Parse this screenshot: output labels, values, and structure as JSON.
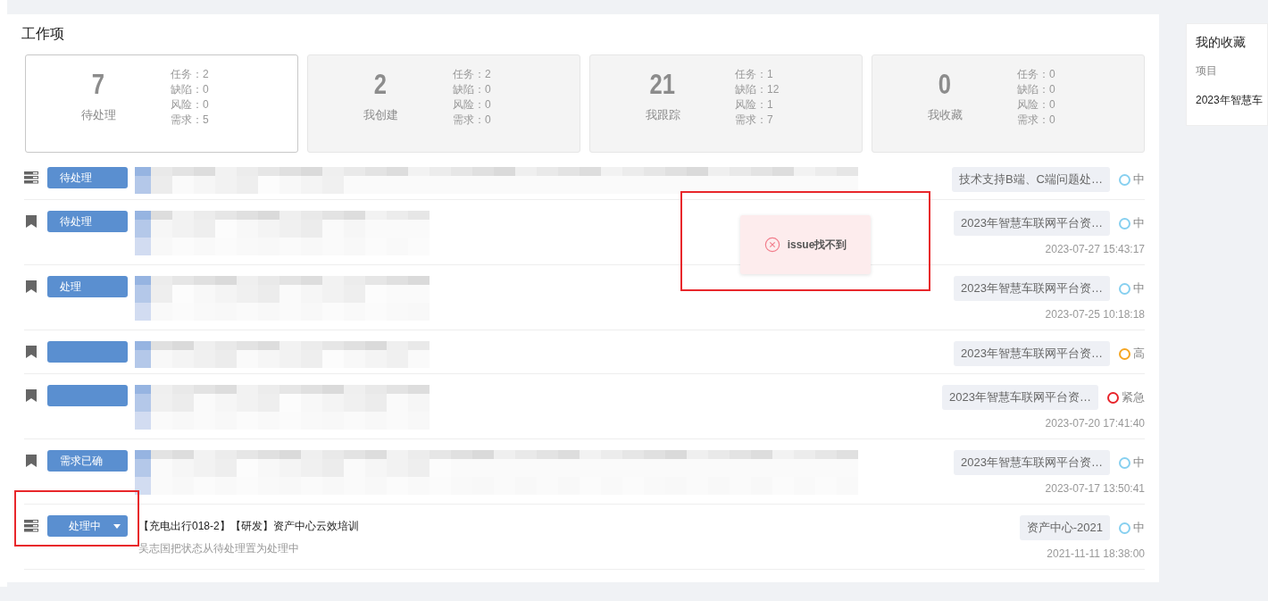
{
  "section_title": "工作项",
  "stat_cards": [
    {
      "count": "7",
      "label": "待处理",
      "selected": true,
      "lines": [
        "任务：2",
        "缺陷：0",
        "风险：0",
        "需求：5"
      ]
    },
    {
      "count": "2",
      "label": "我创建",
      "selected": false,
      "lines": [
        "任务：2",
        "缺陷：0",
        "风险：0",
        "需求：0"
      ]
    },
    {
      "count": "21",
      "label": "我跟踪",
      "selected": false,
      "lines": [
        "任务：1",
        "缺陷：12",
        "风险：1",
        "需求：7"
      ]
    },
    {
      "count": "0",
      "label": "我收藏",
      "selected": false,
      "lines": [
        "任务：0",
        "缺陷：0",
        "风险：0",
        "需求：0"
      ]
    }
  ],
  "rows": [
    {
      "kind": "task",
      "status": "待处理",
      "masked": true,
      "project": "技术支持B端、C端问题处…",
      "priority": "中",
      "color": "#87d0f0"
    },
    {
      "kind": "requirement",
      "status": "待处理",
      "masked": true,
      "project": "2023年智慧车联网平台资…",
      "priority": "中",
      "color": "#87d0f0",
      "time": "2023-07-27 15:43:17"
    },
    {
      "kind": "requirement",
      "status": "处理",
      "masked": true,
      "project": "2023年智慧车联网平台资…",
      "priority": "中",
      "color": "#87d0f0",
      "time": "2023-07-25 10:18:18"
    },
    {
      "kind": "requirement",
      "masked": true,
      "project": "2023年智慧车联网平台资…",
      "priority": "高",
      "color": "#f5a623"
    },
    {
      "kind": "requirement",
      "masked": true,
      "project": "2023年智慧车联网平台资…",
      "priority": "紧急",
      "color": "#e8242b",
      "time": "2023-07-20 17:41:40"
    },
    {
      "kind": "requirement",
      "status": "需求已确",
      "masked": true,
      "project": "2023年智慧车联网平台资…",
      "priority": "中",
      "color": "#87d0f0",
      "time": "2023-07-17 13:50:41"
    },
    {
      "kind": "task",
      "status": "处理中",
      "dropdown": true,
      "masked": false,
      "title": "【充电出行018-2】【研发】资产中心云效培训",
      "subtitle": "吴志国把状态从待处理置为处理中",
      "project": "资产中心-2021",
      "priority": "中",
      "color": "#87d0f0",
      "time": "2021-11-11 18:38:00"
    }
  ],
  "toast": {
    "message": "issue找不到"
  },
  "favorites": {
    "title": "我的收藏",
    "column": "项目",
    "item": "2023年智慧车"
  }
}
